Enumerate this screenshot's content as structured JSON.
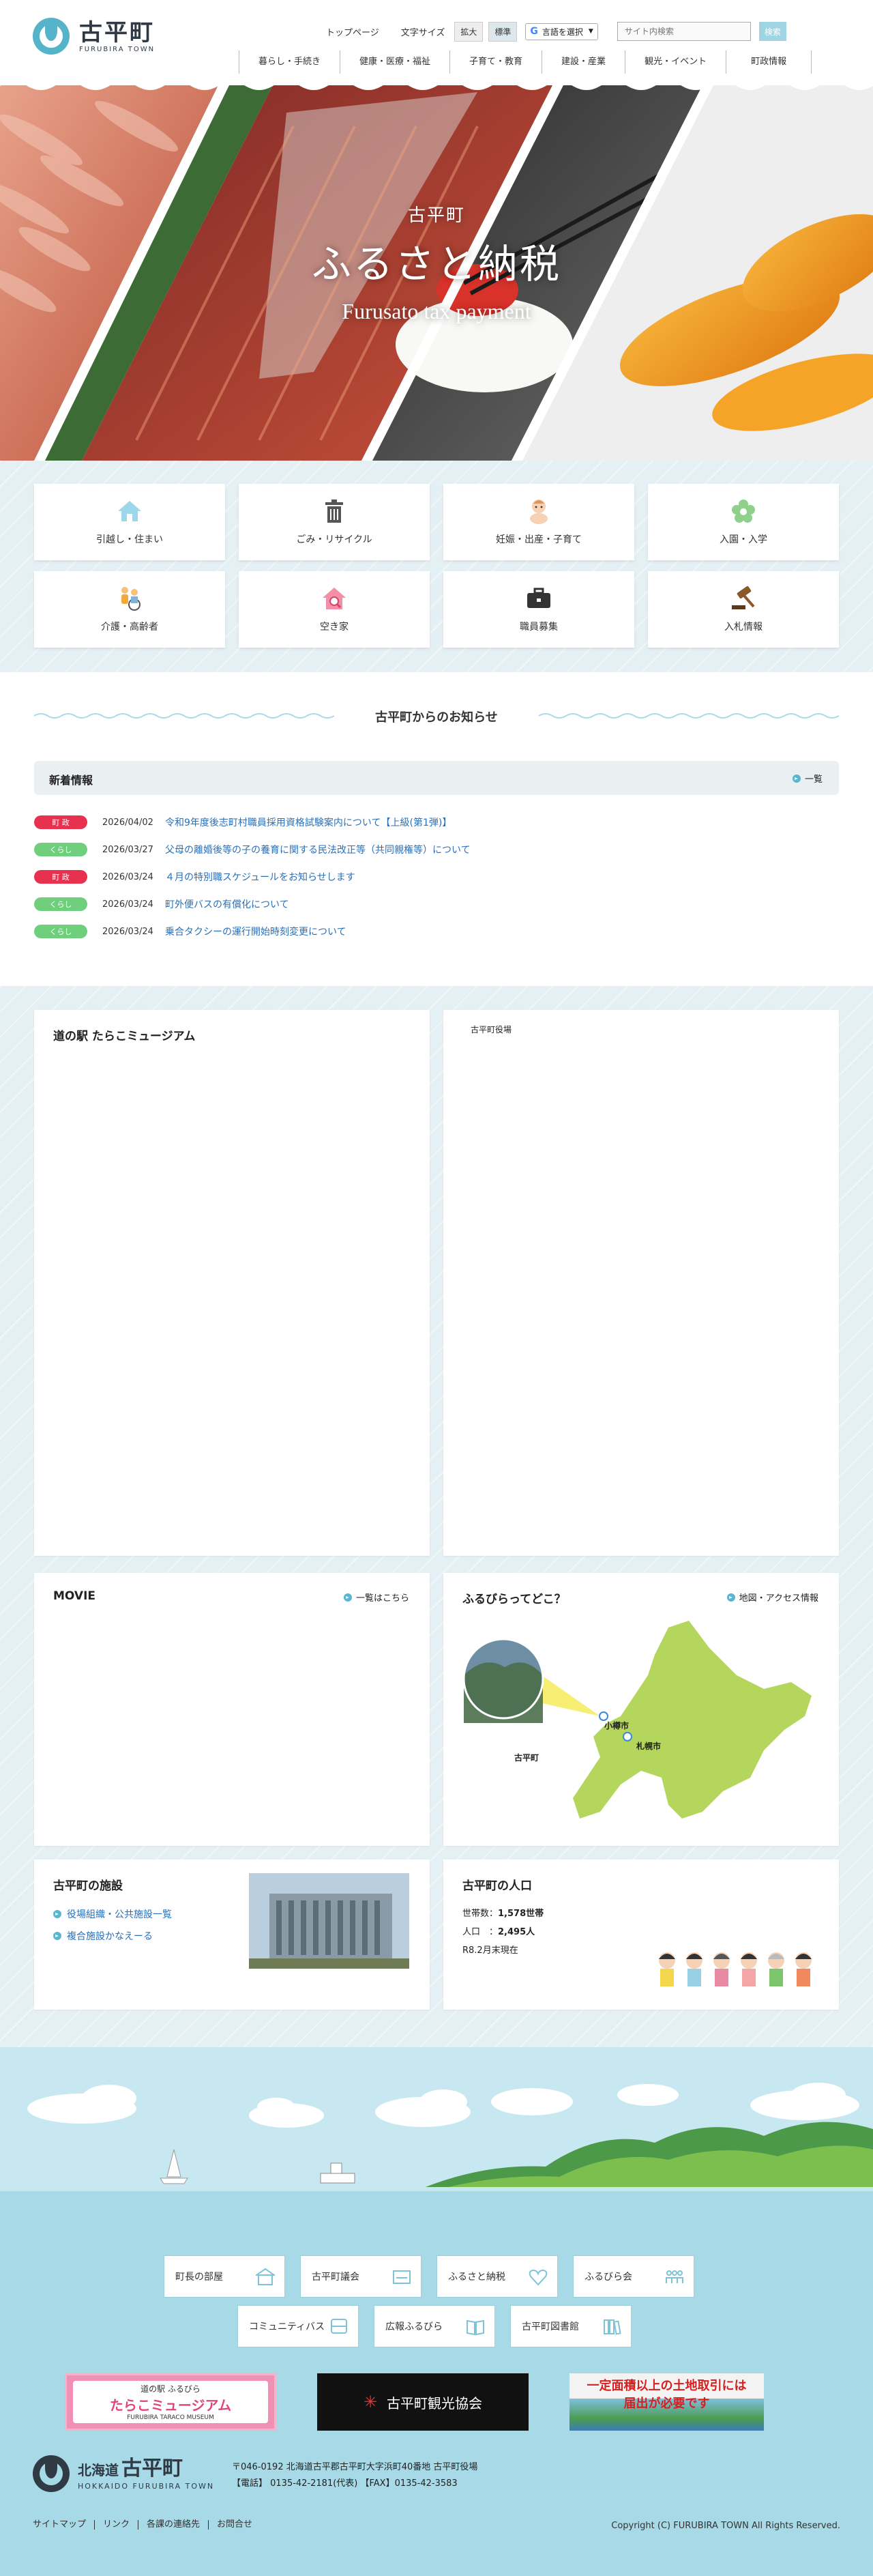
{
  "header": {
    "logo_jp": "古平町",
    "logo_en": "FURUBIRA TOWN",
    "top_link": "トップページ",
    "font_size_label": "文字サイズ",
    "enlarge": "拡大",
    "standard": "標準",
    "language": "言語を選択",
    "search_placeholder": "サイト内検索",
    "search_button": "検索"
  },
  "nav": [
    "暮らし・手続き",
    "健康・医療・福祉",
    "子育て・教育",
    "建設・産業",
    "観光・イベント",
    "町政情報"
  ],
  "hero": {
    "small": "古平町",
    "title": "ふるさと納税",
    "subtitle": "Furusato tax payment"
  },
  "categories": [
    {
      "label": "引越し・住まい",
      "icon": "house-icon"
    },
    {
      "label": "ごみ・リサイクル",
      "icon": "trash-icon"
    },
    {
      "label": "妊娠・出産・子育て",
      "icon": "baby-icon"
    },
    {
      "label": "入園・入学",
      "icon": "flower-icon"
    },
    {
      "label": "介護・高齢者",
      "icon": "elderly-icon"
    },
    {
      "label": "空き家",
      "icon": "vacant-house-icon"
    },
    {
      "label": "職員募集",
      "icon": "briefcase-icon"
    },
    {
      "label": "入札情報",
      "icon": "gavel-icon"
    }
  ],
  "news": {
    "section_title": "古平町からのお知らせ",
    "bar_title": "新着情報",
    "list_link": "一覧",
    "items": [
      {
        "badge": "町 政",
        "badge_color": "#e8304f",
        "date": "2026/04/02",
        "title": "令和9年度後志町村職員採用資格試験案内について【上級(第1弾)】"
      },
      {
        "badge": "くらし",
        "badge_color": "#6fcf7c",
        "date": "2026/03/27",
        "title": "父母の離婚後等の子の養育に関する民法改正等（共同親権等）について"
      },
      {
        "badge": "町 政",
        "badge_color": "#e8304f",
        "date": "2026/03/24",
        "title": "４月の特別職スケジュールをお知らせします"
      },
      {
        "badge": "くらし",
        "badge_color": "#6fcf7c",
        "date": "2026/03/24",
        "title": "町外便バスの有償化について"
      },
      {
        "badge": "くらし",
        "badge_color": "#6fcf7c",
        "date": "2026/03/24",
        "title": "乗合タクシーの運行開始時刻変更について"
      }
    ]
  },
  "widgets": {
    "museum_title": "道の駅 たらこミュージアム",
    "office_title": "古平町役場",
    "movie_title": "MOVIE",
    "movie_link": "一覧はこちら",
    "map_title": "ふるびらってどこ？",
    "map_link": "地図・アクセス情報",
    "map_labels": {
      "furubira": "古平町",
      "otaru": "小樽市",
      "sapporo": "札幌市"
    },
    "facilities_title": "古平町の施設",
    "facilities_links": [
      "役場組織・公共施設一覧",
      "複合施設かなえーる"
    ],
    "population_title": "古平町の人口",
    "households_label": "世帯数：",
    "households_value": "1,578世帯",
    "population_label": "人口　：",
    "population_value": "2,495人",
    "population_date": "R8.2月末現在"
  },
  "footer": {
    "links": [
      "町長の部屋",
      "古平町議会",
      "ふるさと納税",
      "ふるびら会",
      "コミュニティバス",
      "広報ふるびら",
      "古平町図書館"
    ],
    "banner1_top": "道の駅 ふるびら",
    "banner1_main": "たらこミュージアム",
    "banner1_en": "FURUBIRA TARACO MUSEUM",
    "banner2": "古平町観光協会",
    "banner3_line1": "一定面積以上の土地取引には",
    "banner3_line2": "届出が必要です",
    "logo_prefix": "北海道",
    "logo_jp": "古平町",
    "logo_en": "HOKKAIDO FURUBIRA TOWN",
    "address": "〒046-0192 北海道古平郡古平町大字浜町40番地 古平町役場",
    "phone": "【電話】 0135-42-2181(代表) 【FAX】0135-42-3583",
    "bottom_links": [
      "サイトマップ",
      "リンク",
      "各課の連絡先",
      "お問合せ"
    ],
    "copyright": "Copyright (C) FURUBIRA TOWN All Rights Reserved."
  }
}
